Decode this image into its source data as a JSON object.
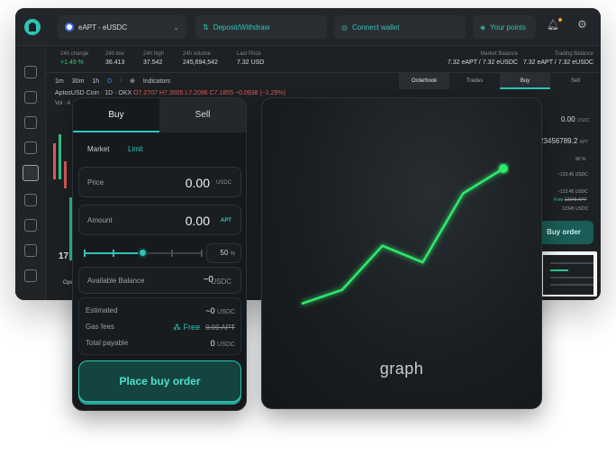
{
  "header": {
    "pair": "eAPT - eUSDC",
    "deposit_label": "Deposit/Withdraw",
    "connect_label": "Connect wallet",
    "points_label": "Your points"
  },
  "stats": [
    {
      "label": "24h change",
      "value": "+1.49 %"
    },
    {
      "label": "24h low",
      "value": "36.413"
    },
    {
      "label": "24h high",
      "value": "37.542"
    },
    {
      "label": "24h volume",
      "value": "245,694,542"
    },
    {
      "label": "Last Price",
      "value": "7.32 USD"
    }
  ],
  "balances": {
    "market_label": "Market Balance",
    "market_value": "7.32 eAPT  /  7.32 eUSDC",
    "trading_label": "Trading Balance",
    "trading_value": "7.32 eAPT  /  7.32 eUSDC"
  },
  "chart_toolbar": {
    "intervals": [
      "1m",
      "30m",
      "1h",
      "D"
    ],
    "indicators_label": "Indicators"
  },
  "symbol_line": {
    "name": "AptosUSD Coin · 1D · OKX",
    "ohlc": "O7.2707 H7.3505 L7.2096 C7.1855 −0.0938 (−1.29%)",
    "vol": "Vol · A"
  },
  "tv_logo": "17",
  "open_label": "Ope",
  "right_tabs": [
    "Orderbook",
    "Trades",
    "Buy",
    "Sell"
  ],
  "right_panel": {
    "price_val": "0.00",
    "price_unit": "USDC",
    "amount_val": "23456789.2",
    "amount_unit": "APT",
    "pct": "90 %",
    "est1": "~123.45",
    "est1_unit": "USDC",
    "est2": "~123.45",
    "est2_unit": "USDC",
    "gas": "Free",
    "gas_strike": "12345 APT",
    "total": "12345",
    "total_unit": "USDC",
    "buy_label": "Buy order"
  },
  "buy_card": {
    "tab_buy": "Buy",
    "tab_sell": "Sell",
    "market_label": "Market",
    "limit_label": "Limit",
    "price": {
      "label": "Price",
      "value": "0.00",
      "unit": "USDC"
    },
    "amount": {
      "label": "Amount",
      "value": "0.00",
      "unit": "APT"
    },
    "slider_percent": 50,
    "percent_value": "50",
    "percent_unit": "%",
    "available": {
      "label": "Available Balance",
      "value": "~0",
      "unit": "USDC"
    },
    "estimated": {
      "label": "Estimated",
      "value": "~0",
      "unit": "USDC"
    },
    "gas": {
      "label": "Gas fees",
      "value": "Free",
      "strike": "0.00 APT"
    },
    "total": {
      "label": "Total payable",
      "value": "0",
      "unit": "USDC"
    },
    "place_label": "Place buy order"
  },
  "graph_card": {
    "label": "graph",
    "line_color": "#2ee86a",
    "points": [
      [
        0,
        0
      ],
      [
        1,
        0.25
      ],
      [
        2,
        1.05
      ],
      [
        3,
        0.75
      ],
      [
        4,
        2.0
      ],
      [
        5,
        2.45
      ]
    ]
  },
  "colors": {
    "accent": "#2ec4b6",
    "positive": "#34c97a",
    "negative": "#e35b5b"
  }
}
